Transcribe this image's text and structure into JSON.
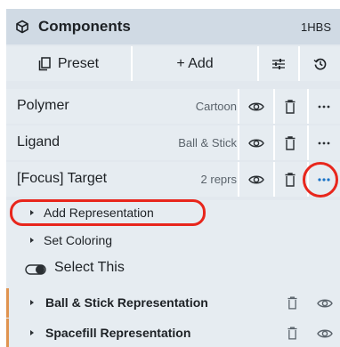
{
  "header": {
    "title": "Components",
    "pdb_id": "1HBS",
    "icon": "cube-icon"
  },
  "toolbar": {
    "preset_label": "Preset",
    "add_label": "+ Add",
    "preset_icon": "preset-icon",
    "options_icon": "sliders-icon",
    "undo_icon": "history-icon"
  },
  "components": [
    {
      "name": "Polymer",
      "repr": "Cartoon"
    },
    {
      "name": "Ligand",
      "repr": "Ball & Stick"
    },
    {
      "name": "[Focus] Target",
      "repr": "2 reprs"
    }
  ],
  "actions": {
    "add_representation": "Add Representation",
    "set_coloring": "Set Coloring",
    "select_this": "Select This"
  },
  "representations": [
    {
      "label": "Ball & Stick Representation"
    },
    {
      "label": "Spacefill Representation"
    }
  ],
  "colors": {
    "header_bg": "#d0dae4",
    "row_bg": "#e6ecf1",
    "accent": "#e09450",
    "highlight": "#e8261c",
    "more_active": "#1a73c7"
  }
}
